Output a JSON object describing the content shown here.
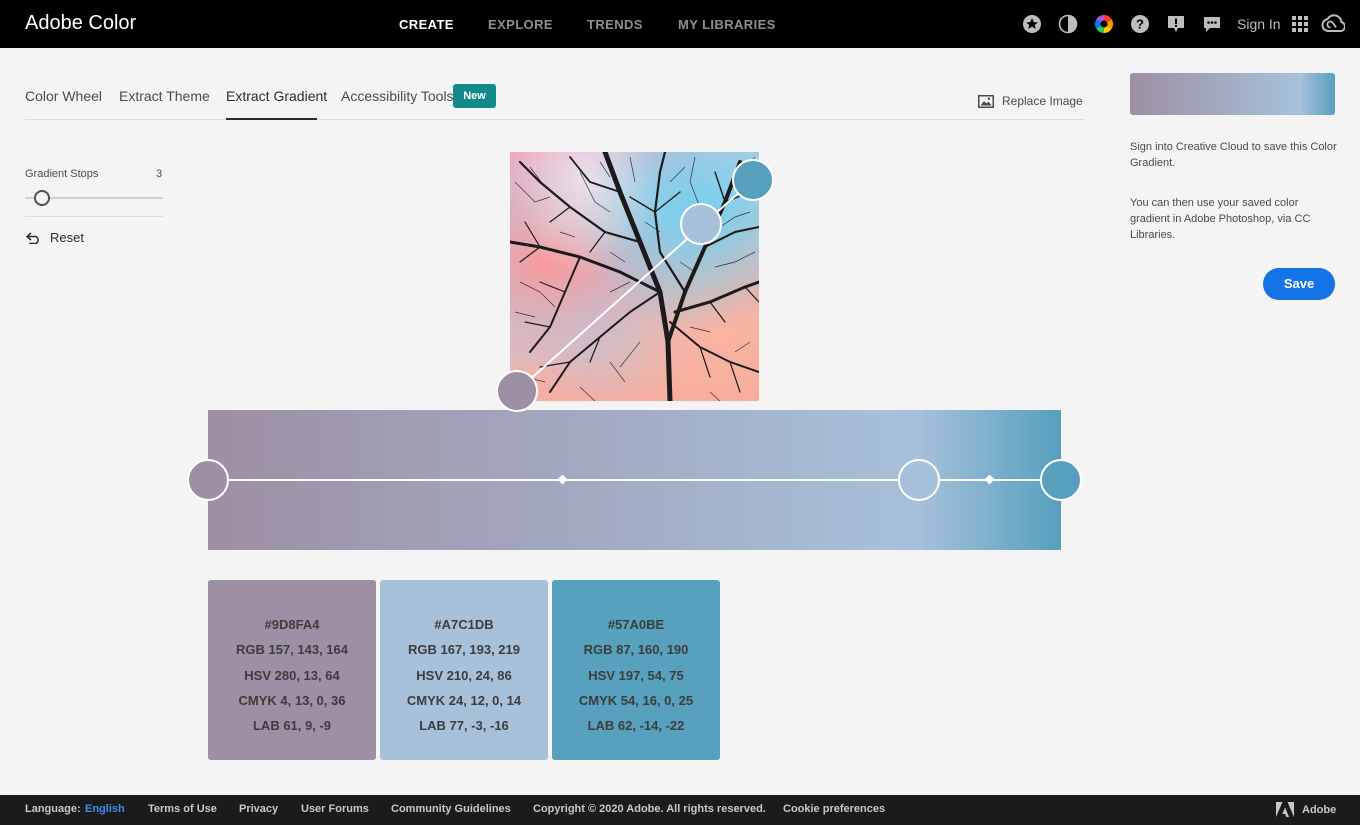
{
  "app": {
    "title": "Adobe Color"
  },
  "nav": {
    "items": [
      {
        "label": "CREATE",
        "active": true
      },
      {
        "label": "EXPLORE",
        "active": false
      },
      {
        "label": "TRENDS",
        "active": false
      },
      {
        "label": "MY LIBRARIES",
        "active": false
      }
    ],
    "icons": [
      "star-icon",
      "contrast-icon",
      "color-wheel-icon",
      "help-icon",
      "feedback-icon",
      "chat-icon",
      "apps-grid-icon",
      "creative-cloud-icon"
    ],
    "sign_in": "Sign In"
  },
  "tabs": {
    "items": [
      {
        "label": "Color Wheel"
      },
      {
        "label": "Extract Theme"
      },
      {
        "label": "Extract Gradient",
        "active": true
      },
      {
        "label": "Accessibility Tools"
      }
    ],
    "new_badge": "New",
    "replace_image": "Replace Image"
  },
  "left_panel": {
    "gradient_stops_label": "Gradient Stops",
    "gradient_stops_value": "3",
    "reset_label": "Reset"
  },
  "gradient": {
    "colors": [
      "#9D8FA4",
      "#A7C1DB",
      "#57A0BE"
    ],
    "stop_positions_percent": [
      0,
      83,
      100
    ]
  },
  "swatches": [
    {
      "hex": "#9D8FA4",
      "rgb": "RGB 157, 143, 164",
      "hsv": "HSV 280, 13, 64",
      "cmyk": "CMYK 4, 13, 0, 36",
      "lab": "LAB 61, 9, -9"
    },
    {
      "hex": "#A7C1DB",
      "rgb": "RGB 167, 193, 219",
      "hsv": "HSV 210, 24, 86",
      "cmyk": "CMYK 24, 12, 0, 14",
      "lab": "LAB 77, -3, -16"
    },
    {
      "hex": "#57A0BE",
      "rgb": "RGB 87, 160, 190",
      "hsv": "HSV 197, 54, 75",
      "cmyk": "CMYK 54, 16, 0, 25",
      "lab": "LAB 62, -14, -22"
    }
  ],
  "right_panel": {
    "sign_in_note": "Sign into Creative Cloud to save this Color Gradient.",
    "usage_note": "You can then use your saved color gradient in Adobe Photoshop, via CC Libraries.",
    "save_label": "Save"
  },
  "footer": {
    "language_label": "Language:",
    "language_value": "English",
    "links": [
      "Terms of Use",
      "Privacy",
      "User Forums",
      "Community Guidelines"
    ],
    "copyright": "Copyright © 2020 Adobe. All rights reserved.",
    "cookie": "Cookie preferences",
    "brand": "Adobe"
  },
  "colors": {
    "accent_blue": "#1473e6",
    "badge_teal": "#128a8a",
    "topbar": "#000000",
    "footer": "#1b1b1b"
  }
}
